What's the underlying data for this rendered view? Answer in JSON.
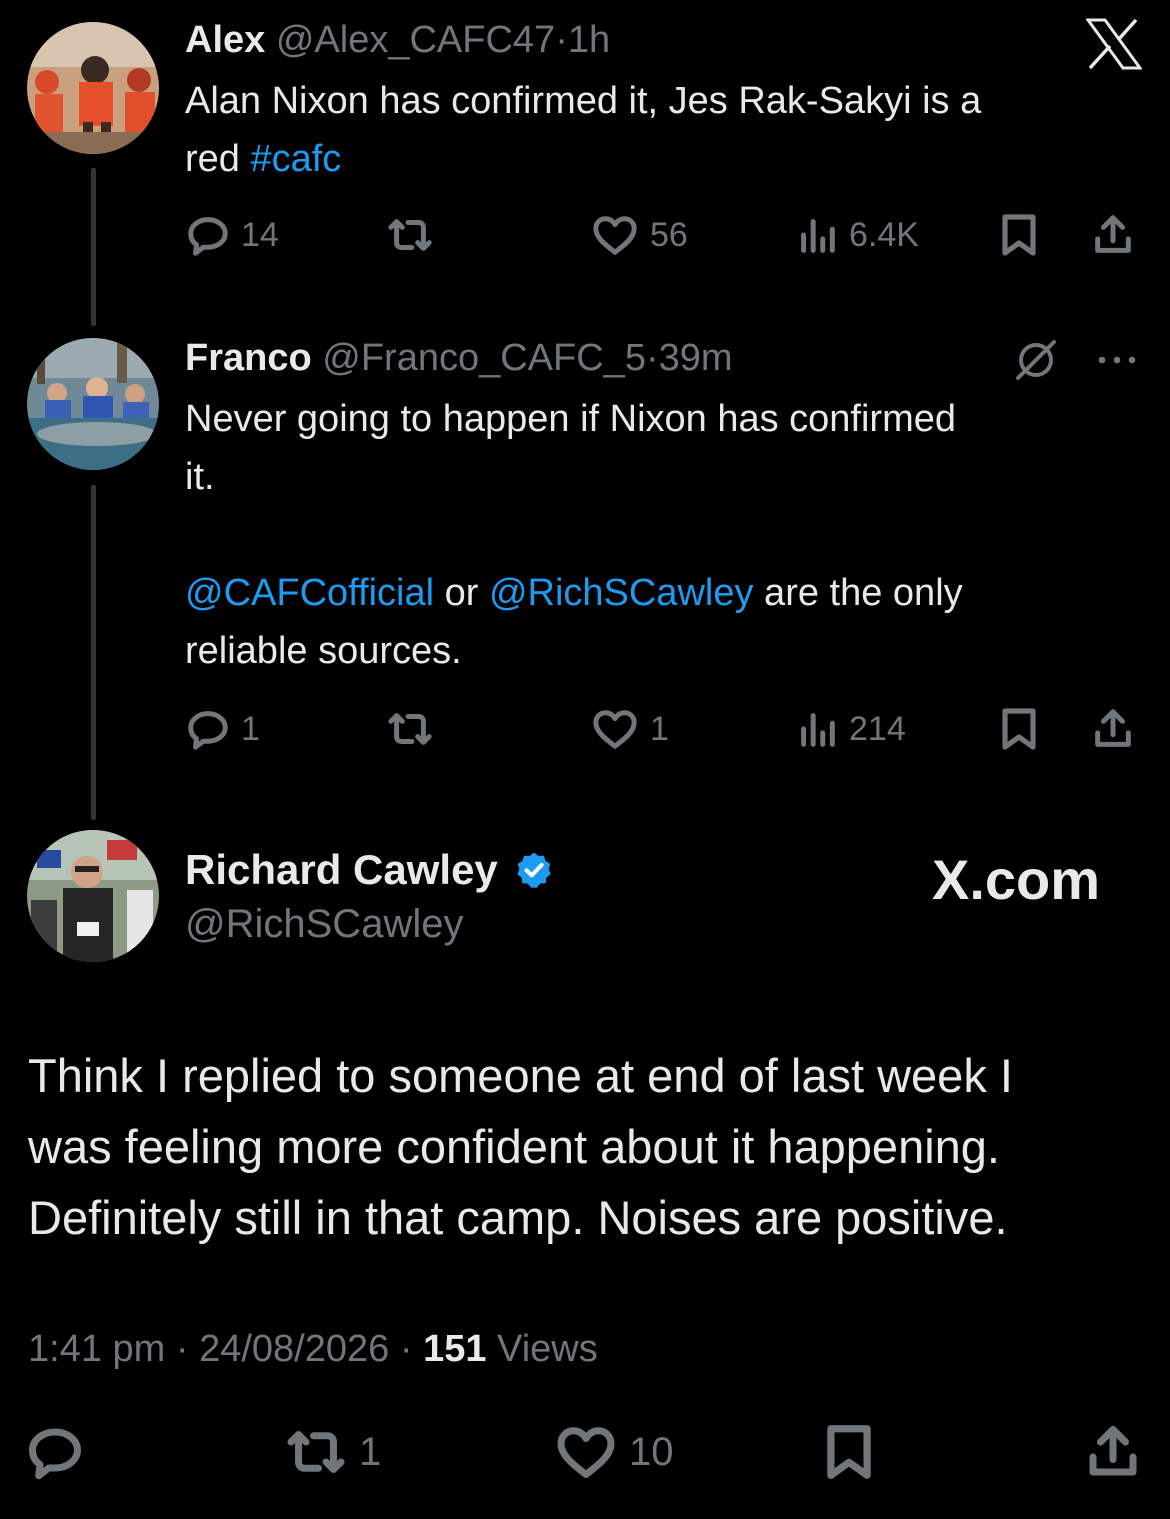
{
  "brand": {
    "x_logo": "X",
    "x_com": "X.com",
    "accent": "#1d9bf0"
  },
  "tweets": [
    {
      "name": "Alex",
      "handle": "@Alex_CAFC47",
      "sep": "·",
      "time": "1h",
      "text_1": "Alan Nixon has confirmed it, Jes Rak-Sakyi is a",
      "text_2": "red ",
      "hashtag": "#cafc",
      "replies": "14",
      "reposts": "",
      "likes": "56",
      "views": "6.4K"
    },
    {
      "name": "Franco",
      "handle": "@Franco_CAFC_5",
      "sep": "·",
      "time": "39m",
      "text_1": "Never going to happen if Nixon has confirmed",
      "text_2": "it.",
      "mention_1": "@CAFCofficial",
      "or_text": " or ",
      "mention_2": "@RichSCawley",
      "text_3": " are the only",
      "text_4": "reliable sources.",
      "replies": "1",
      "reposts": "",
      "likes": "1",
      "views": "214"
    }
  ],
  "main_tweet": {
    "name": "Richard Cawley",
    "handle": "@RichSCawley",
    "line_1": "Think I replied to someone at end of last week I",
    "line_2": "was feeling more confident about it happening.",
    "line_3": "Definitely still in that camp. Noises are positive.",
    "time": "1:41 pm",
    "sep": "·",
    "date": "24/08/2026",
    "views_count": "151",
    "views_label": "Views",
    "replies": "",
    "reposts": "1",
    "likes": "10"
  },
  "icons": {
    "reply": "reply-icon",
    "repost": "repost-icon",
    "like": "heart-icon",
    "views": "views-icon",
    "bookmark": "bookmark-icon",
    "share": "share-icon",
    "grok": "grok-icon",
    "more": "more-icon",
    "verified": "verified-badge-icon"
  }
}
